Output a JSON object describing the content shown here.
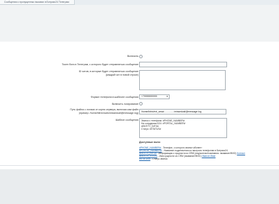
{
  "tab": {
    "label": "Сообщения о пропущенных вызовах в Битрикс24 Телеграм"
  },
  "form": {
    "enable_label": "Включить",
    "token_label": "Токен бота в Телеграм, с которого будет отправляться сообщение",
    "token_value": "",
    "ids_label_line1": "ID чатов, в которые будет отправляться сообщение",
    "ids_label_line2": "(каждый чат в новой строке)",
    "ids_value": "",
    "phone_format_label": "Формат телефона в шаблоне сообщения",
    "phone_format_value": "+79999999999",
    "logging_label": "Включить логирование",
    "log_path_label_line1": "Путь файла с логами от корня сервера, включая сам файл",
    "log_path_label_line2": "(пример: /home/bitrix/www/missedcall@message.log)",
    "log_path_value": "/home/bitrix/ext_www/.............../missedcall@message.log",
    "template_label": "Шаблон сообщения",
    "template_value": "Звонок с телефона: #PHONE_NUMBER#\nНа сотрудника Б24: #PORTAL_NUMBER#\n#ENTITY_INFO#\nСтатус: #STATUS#"
  },
  "variables": {
    "title": "Доступные поля:",
    "items": [
      {
        "code": "#PHONE_NUMBER#",
        "desc": " - Телефон, с которого звонил абонент",
        "extra": ""
      },
      {
        "code": "#PORTAL_NUMBER#",
        "desc": " - Название подключения из настроек телефонии в Битрикс24",
        "extra": ""
      },
      {
        "code": "#ENTITY_INFO#",
        "desc": " - Информация о сущности из CRM (лид/контакт/компания: название/ФИО) ",
        "extra": "Контакт"
      },
      {
        "code": "#ENTITY_TITLE#",
        "desc": " - Имя сущности из CRM (название/ФИО) ",
        "extra": "Иванов Иван"
      },
      {
        "code": "#STATUS#",
        "desc": " - Статус звонка",
        "extra": ""
      }
    ]
  }
}
